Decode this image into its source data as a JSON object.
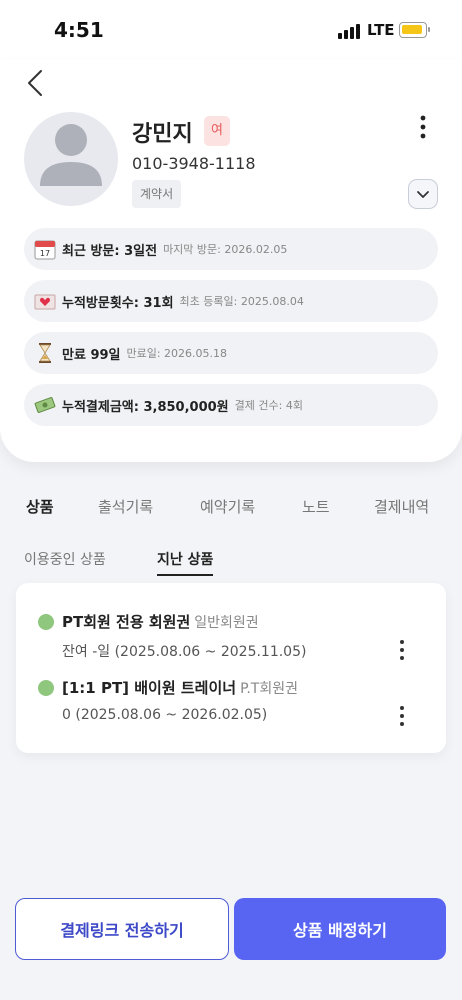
{
  "status_bar": {
    "time": "4:51",
    "network": "LTE"
  },
  "profile": {
    "name": "강민지",
    "gender": "여",
    "phone": "010-3948-1118",
    "contract_label": "계약서"
  },
  "info_rows": [
    {
      "icon": "calendar-icon",
      "main": "최근 방문: 3일전",
      "sub": "마지막 방문: 2026.02.05"
    },
    {
      "icon": "heart-envelope-icon",
      "main": "누적방문횟수: 31회",
      "sub": "최초 등록일: 2025.08.04"
    },
    {
      "icon": "hourglass-icon",
      "main": "만료 99일",
      "sub": "만료일: 2026.05.18"
    },
    {
      "icon": "money-icon",
      "main": "누적결제금액: 3,850,000원",
      "sub": "결제 건수: 4회"
    }
  ],
  "tabs": [
    "상품",
    "출석기록",
    "예약기록",
    "노트",
    "결제내역"
  ],
  "subtabs": [
    "이용중인 상품",
    "지난 상품"
  ],
  "products": [
    {
      "title": "PT회원 전용 회원권",
      "type": "일반회원권",
      "detail": "잔여 -일 (2025.08.06 ~ 2025.11.05)"
    },
    {
      "title": "[1:1 PT] 배이원 트레이너",
      "type": "P.T회원권",
      "detail": "0 (2025.08.06 ~ 2026.02.05)"
    }
  ],
  "buttons": {
    "send_payment_link": "결제링크 전송하기",
    "assign_product": "상품 배정하기"
  },
  "colors": {
    "accent": "#5865f2",
    "status_dot": "#8fc77e",
    "gender_badge": "#fde2e2"
  }
}
